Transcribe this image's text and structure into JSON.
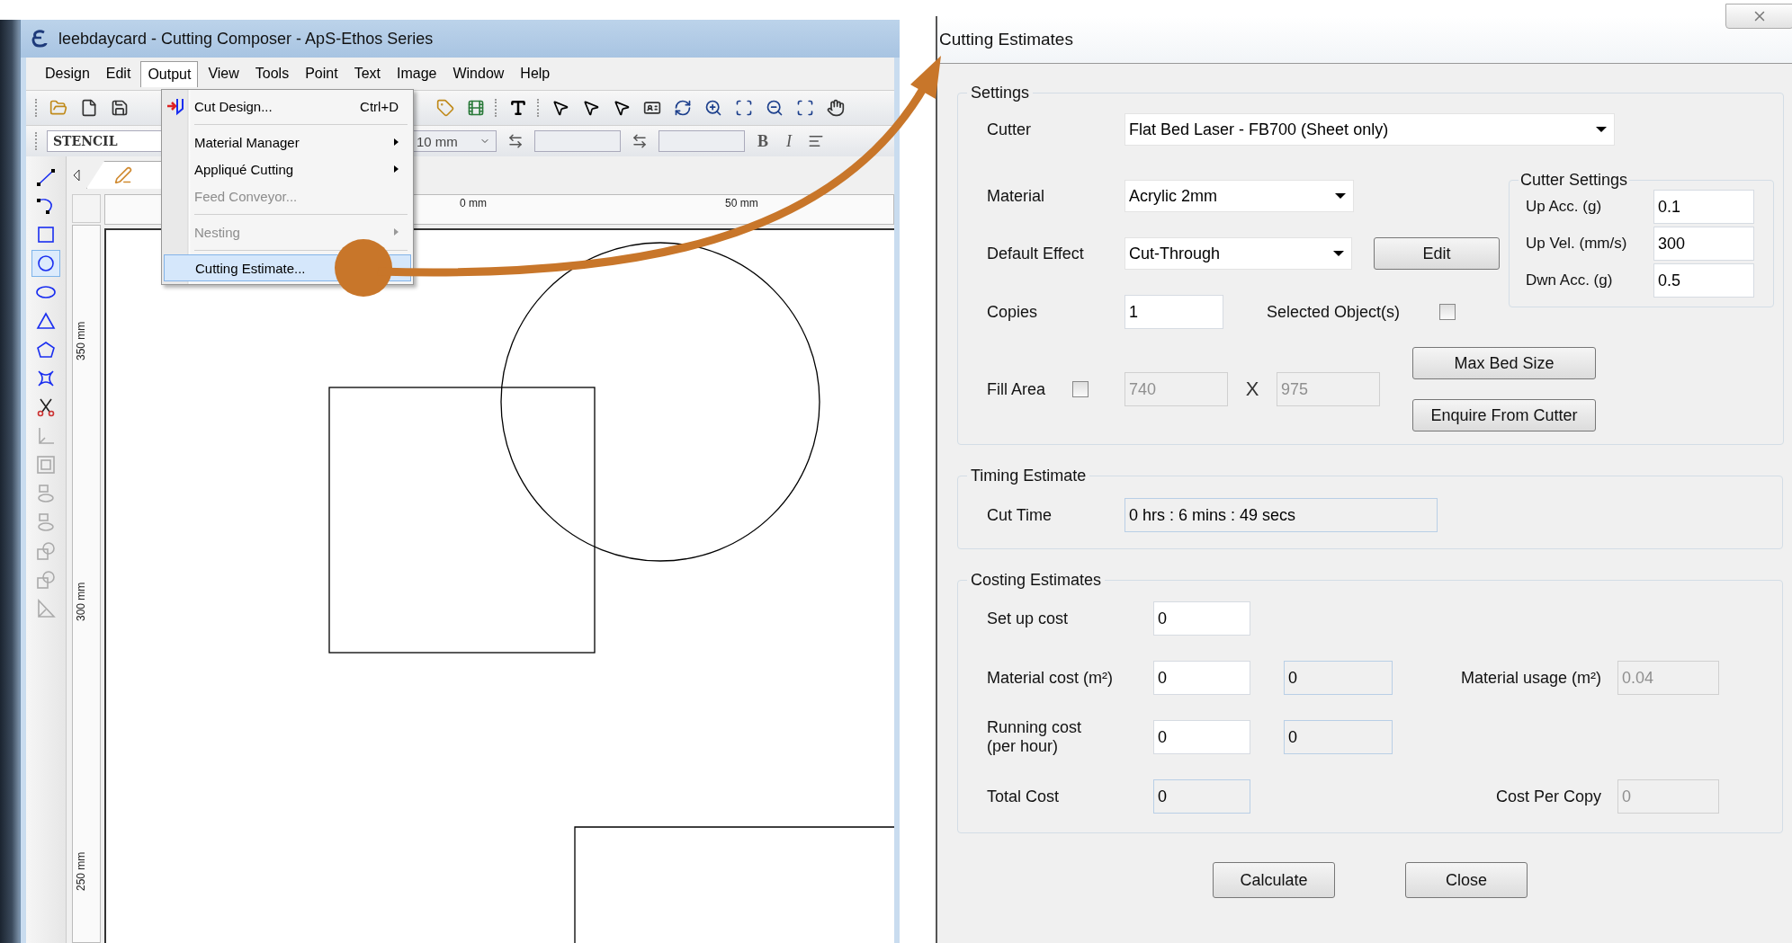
{
  "app": {
    "title": "leebdaycard - Cutting Composer - ApS-Ethos Series",
    "menu": [
      {
        "label": "Design",
        "selected": false
      },
      {
        "label": "Edit",
        "selected": false
      },
      {
        "label": "Output",
        "selected": true
      },
      {
        "label": "View",
        "selected": false
      },
      {
        "label": "Tools",
        "selected": false
      },
      {
        "label": "Point",
        "selected": false
      },
      {
        "label": "Text",
        "selected": false
      },
      {
        "label": "Image",
        "selected": false
      },
      {
        "label": "Window",
        "selected": false
      },
      {
        "label": "Help",
        "selected": false
      }
    ],
    "font_box": {
      "value": "STENCIL"
    },
    "size_box": {
      "value": "10 mm"
    },
    "format_buttons": [
      "B",
      "I"
    ],
    "tools": [
      {
        "kind": "line",
        "selected": false,
        "disabled": false
      },
      {
        "kind": "curve",
        "selected": false,
        "disabled": false
      },
      {
        "kind": "rectangle",
        "selected": false,
        "disabled": false
      },
      {
        "kind": "circle",
        "selected": true,
        "disabled": false
      },
      {
        "kind": "ellipse",
        "selected": false,
        "disabled": false
      },
      {
        "kind": "triangle",
        "selected": false,
        "disabled": false
      },
      {
        "kind": "pentagon",
        "selected": false,
        "disabled": false
      },
      {
        "kind": "star",
        "selected": false,
        "disabled": false
      },
      {
        "kind": "scissors",
        "selected": false,
        "disabled": false
      },
      {
        "kind": "axis",
        "selected": false,
        "disabled": true
      },
      {
        "kind": "nested",
        "selected": false,
        "disabled": true
      },
      {
        "kind": "stack",
        "selected": false,
        "disabled": true
      },
      {
        "kind": "stack",
        "selected": false,
        "disabled": true
      },
      {
        "kind": "overlap",
        "selected": false,
        "disabled": true
      },
      {
        "kind": "overlap",
        "selected": false,
        "disabled": true
      },
      {
        "kind": "angle",
        "selected": false,
        "disabled": true
      }
    ],
    "rulers": {
      "top": [
        "0 mm",
        "50 mm"
      ],
      "left": [
        "350 mm",
        "300 mm",
        "250 mm"
      ]
    },
    "output_menu": [
      {
        "label": "Cut Design...",
        "shortcut": "Ctrl+D",
        "disabled": false,
        "submenu": false,
        "selected": false,
        "separator_after": true
      },
      {
        "label": "Material Manager",
        "disabled": false,
        "submenu": true,
        "selected": false,
        "separator_after": false
      },
      {
        "label": "Appliqué Cutting",
        "disabled": false,
        "submenu": true,
        "selected": false,
        "separator_after": false
      },
      {
        "label": "Feed Conveyor...",
        "disabled": true,
        "submenu": false,
        "selected": false,
        "separator_after": true
      },
      {
        "label": "Nesting",
        "disabled": true,
        "submenu": true,
        "selected": false,
        "separator_after": true
      },
      {
        "label": "Cutting Estimate...",
        "disabled": false,
        "submenu": false,
        "selected": true,
        "separator_after": false
      }
    ]
  },
  "dialog": {
    "title": "Cutting Estimates",
    "settings": {
      "title": "Settings",
      "cutter": {
        "label": "Cutter",
        "value": "Flat Bed Laser - FB700 (Sheet only)"
      },
      "material": {
        "label": "Material",
        "value": "Acrylic 2mm"
      },
      "default_effect": {
        "label": "Default Effect",
        "value": "Cut-Through"
      },
      "edit_button": "Edit",
      "copies": {
        "label": "Copies",
        "value": "1"
      },
      "selected_objects": {
        "label": "Selected Object(s)",
        "checked": false
      },
      "fill_area": {
        "label": "Fill Area",
        "checked": false,
        "width": {
          "value": "740",
          "kind": "disabled"
        },
        "separator": "X",
        "height": {
          "value": "975",
          "kind": "disabled"
        }
      },
      "max_bed_button": "Max Bed Size",
      "enquire_button": "Enquire From Cutter"
    },
    "cutter_settings": {
      "title": "Cutter Settings",
      "fields": [
        {
          "label": "Up Acc. (g)",
          "value": "0.1",
          "kind": "input"
        },
        {
          "label": "Up Vel. (mm/s)",
          "value": "300",
          "kind": "input"
        },
        {
          "label": "Dwn Acc. (g)",
          "value": "0.5",
          "kind": "input"
        }
      ]
    },
    "timing": {
      "title": "Timing Estimate",
      "cut_time": {
        "label": "Cut Time",
        "value": "0 hrs : 6 mins : 49 secs",
        "kind": "readonly"
      }
    },
    "costing": {
      "title": "Costing Estimates",
      "rows": [
        {
          "label": "Set up cost",
          "fields": [
            {
              "value": "0",
              "kind": "input"
            }
          ]
        },
        {
          "label": "Material cost (m²)",
          "fields": [
            {
              "value": "0",
              "kind": "input"
            },
            {
              "value": "0",
              "kind": "readonly"
            }
          ],
          "extra": {
            "label": "Material usage (m²)",
            "value": "0.04",
            "kind": "disabled"
          }
        },
        {
          "label": "Running cost\n(per hour)",
          "fields": [
            {
              "value": "0",
              "kind": "input"
            },
            {
              "value": "0",
              "kind": "readonly"
            }
          ]
        },
        {
          "label": "Total Cost",
          "fields": [
            {
              "value": "0",
              "kind": "readonly"
            }
          ],
          "extra": {
            "label": "Cost Per Copy",
            "value": "0",
            "kind": "disabled"
          }
        }
      ]
    },
    "buttons": [
      "Calculate",
      "Close"
    ]
  }
}
